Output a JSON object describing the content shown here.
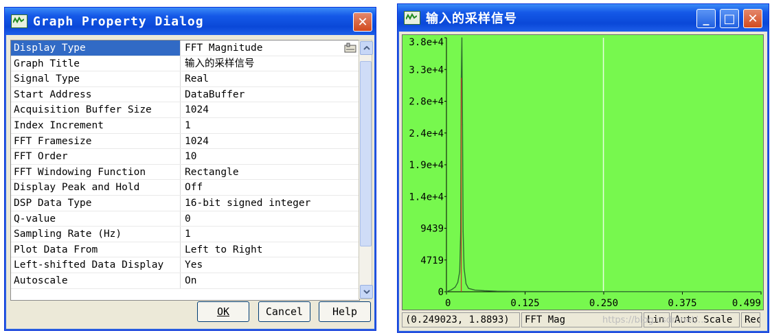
{
  "dialog": {
    "title": "Graph Property Dialog",
    "rows": [
      {
        "name": "Display Type",
        "value": "FFT Magnitude"
      },
      {
        "name": "Graph Title",
        "value": "输入的采样信号"
      },
      {
        "name": "Signal Type",
        "value": "Real"
      },
      {
        "name": "Start Address",
        "value": "DataBuffer"
      },
      {
        "name": "Acquisition Buffer Size",
        "value": "1024"
      },
      {
        "name": "Index Increment",
        "value": "1"
      },
      {
        "name": "FFT Framesize",
        "value": "1024"
      },
      {
        "name": "FFT Order",
        "value": "10"
      },
      {
        "name": "FFT Windowing Function",
        "value": "Rectangle"
      },
      {
        "name": "Display Peak and Hold",
        "value": "Off"
      },
      {
        "name": "DSP Data Type",
        "value": "16-bit signed integer"
      },
      {
        "name": "Q-value",
        "value": "0"
      },
      {
        "name": "Sampling Rate (Hz)",
        "value": "1"
      },
      {
        "name": "Plot Data From",
        "value": "Left to Right"
      },
      {
        "name": "Left-shifted Data Display",
        "value": "Yes"
      },
      {
        "name": "Autoscale",
        "value": "On"
      }
    ],
    "buttons": {
      "ok": "OK",
      "cancel": "Cancel",
      "help": "Help"
    },
    "close_glyph": "✕"
  },
  "graph": {
    "title": "输入的采样信号",
    "background_color": "#77f84e",
    "trace_color": "#2f6d2f",
    "peak_color": "#c0392b",
    "status": {
      "cursor": "(0.249023, 1.8893)",
      "mode": "FFT Mag",
      "scale_type": "Lin",
      "auto_scale": "Auto Scale",
      "extra": "Rec"
    },
    "watermark": "https://blog.csdn.net/...",
    "caption_buttons": {
      "minimize": "_",
      "maximize": "□",
      "close": "✕"
    }
  },
  "chart_data": {
    "type": "line",
    "title": "输入的采样信号",
    "xlabel": "",
    "ylabel": "",
    "x_ticks": [
      "0",
      "0.125",
      "0.250",
      "0.375",
      "0.499"
    ],
    "y_ticks": [
      "0",
      "4719",
      "9439",
      "1.4e+4",
      "1.9e+4",
      "2.4e+4",
      "2.8e+4",
      "3.3e+4",
      "3.8e+4"
    ],
    "xlim": [
      0,
      0.499
    ],
    "ylim": [
      0,
      38000
    ],
    "grid": false,
    "cursor_x": 0.249023,
    "series": [
      {
        "x": [
          0,
          0.008,
          0.014,
          0.018,
          0.021,
          0.0225,
          0.0235,
          0.0245,
          0.0255,
          0.0265,
          0.028,
          0.031,
          0.035,
          0.045,
          0.06,
          0.08,
          0.12,
          0.25,
          0.375,
          0.499
        ],
        "y": [
          0,
          300,
          700,
          1400,
          3000,
          9000,
          32000,
          38000,
          25000,
          9000,
          3500,
          1200,
          500,
          250,
          150,
          80,
          40,
          20,
          10,
          0
        ]
      }
    ]
  }
}
